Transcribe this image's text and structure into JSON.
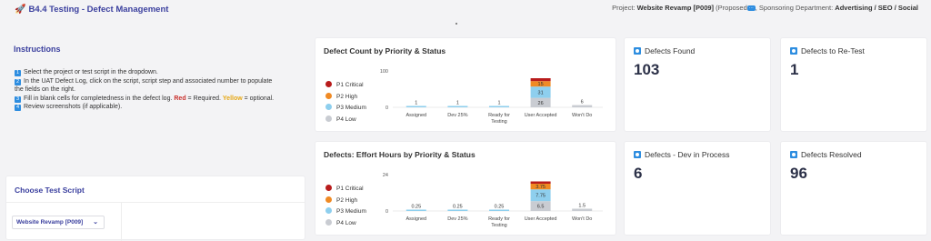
{
  "header": {
    "title": "B4.4 Testing - Defect Management",
    "project_label": "Project: ",
    "project_value": "Website Revamp [P009]",
    "project_status": " (Proposed",
    "sponsor_label": ", Sponsoring Department: ",
    "sponsor_value": "Advertising / SEO / Social"
  },
  "instructions": {
    "title": "Instructions",
    "step1_num": "1",
    "step1": "Select the project or test script in the dropdown.",
    "step2_num": "2",
    "step2": "In the UAT Defect Log, click on the script, script step and associated number to populate",
    "step2_cont": "the fields on the right.",
    "step3_num": "3",
    "step3_pre": "Fill in blank cells for completedness in the defect log. ",
    "step3_red": "Red",
    "step3_mid": " = Required. ",
    "step3_yellow": "Yellow",
    "step3_post": " = optional.",
    "step4_num": "4",
    "step4": "Review screenshots (if applicable)."
  },
  "choose": {
    "title": "Choose Test Script",
    "selected": "Website Revamp [P009]"
  },
  "legend": [
    "P1 Critical",
    "P2 High",
    "P3 Medium",
    "P4 Low"
  ],
  "colors": {
    "p1": "#b81c1c",
    "p2": "#f08a24",
    "p3": "#8ecfee",
    "p4": "#c9ccd2",
    "accent": "#3a3f9e",
    "icon": "#2d8de0"
  },
  "chart_data": [
    {
      "type": "bar",
      "title": "Defect Count by Priority & Status",
      "categories": [
        "Assigned",
        "Dev 25%",
        "Ready for Testing",
        "User Accepted",
        "Won't Do"
      ],
      "ylim": [
        0,
        100
      ],
      "yticks": [
        "0",
        "100"
      ],
      "series": [
        {
          "name": "P4 Low",
          "values": [
            0,
            0,
            0,
            26,
            6
          ]
        },
        {
          "name": "P3 Medium",
          "values": [
            1,
            1,
            1,
            31,
            0
          ]
        },
        {
          "name": "P2 High",
          "values": [
            0,
            0,
            0,
            15,
            0
          ]
        },
        {
          "name": "P1 Critical",
          "values": [
            0,
            0,
            0,
            8,
            0
          ]
        }
      ],
      "labels": [
        {
          "cat": 0,
          "text": "1"
        },
        {
          "cat": 1,
          "text": "1"
        },
        {
          "cat": 2,
          "text": "1"
        },
        {
          "cat": 3,
          "series": 0,
          "text": "26"
        },
        {
          "cat": 3,
          "series": 1,
          "text": "31"
        },
        {
          "cat": 3,
          "series": 2,
          "text": "15"
        },
        {
          "cat": 4,
          "text": "6"
        }
      ]
    },
    {
      "type": "bar",
      "title": "Defects: Effort Hours by Priority & Status",
      "categories": [
        "Assigned",
        "Dev 25%",
        "Ready for Testing",
        "User Accepted",
        "Won't Do"
      ],
      "ylim": [
        0,
        24
      ],
      "yticks": [
        "0",
        "24"
      ],
      "series": [
        {
          "name": "P4 Low",
          "values": [
            0,
            0,
            0,
            6.5,
            1.5
          ]
        },
        {
          "name": "P3 Medium",
          "values": [
            0.25,
            0.25,
            0.25,
            7.75,
            0
          ]
        },
        {
          "name": "P2 High",
          "values": [
            0,
            0,
            0,
            3.75,
            0
          ]
        },
        {
          "name": "P1 Critical",
          "values": [
            0,
            0,
            0,
            1.5,
            0
          ]
        }
      ],
      "labels": [
        {
          "cat": 0,
          "text": "0.25"
        },
        {
          "cat": 1,
          "text": "0.25"
        },
        {
          "cat": 2,
          "text": "0.25"
        },
        {
          "cat": 3,
          "series": 0,
          "text": "6.5"
        },
        {
          "cat": 3,
          "series": 1,
          "text": "7.75"
        },
        {
          "cat": 3,
          "series": 2,
          "text": "3.75"
        },
        {
          "cat": 4,
          "text": "1.5"
        }
      ]
    }
  ],
  "kpis": [
    {
      "label": "Defects Found",
      "value": "103"
    },
    {
      "label": "Defects to Re-Test",
      "value": "1"
    },
    {
      "label": "Defects - Dev in Process",
      "value": "6"
    },
    {
      "label": "Defects Resolved",
      "value": "96"
    }
  ]
}
